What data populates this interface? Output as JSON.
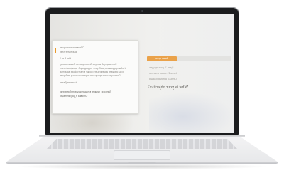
{
  "screen": {
    "card_lines": [
      "Обновление настроек",
      "Выберите план",
      "Шаг 1 из 3",
      "Ваш текущий аккаунт был создан по бизнес-плану.",
      "Чтобы продолжить, выберите подходящий тарифный план,",
      "и вы сможете изменить его позже в настройках аккаунта.",
      "Посмотрите все доступные варианты перед выбором.",
      "Нажмите Далее",
      "Вопросы: пишите в поддержку в любое время",
      "Справка и документация"
    ],
    "badge_label": "Ваши цели",
    "right_lines": [
      "Цель 1: рост продаж",
      "Цель 2: новые клиенты",
      "Цель 3: автоматизация"
    ],
    "question": "What is your objective?"
  },
  "colors": {
    "accent": "#eaa24a",
    "bezel": "#1b1c1e"
  }
}
